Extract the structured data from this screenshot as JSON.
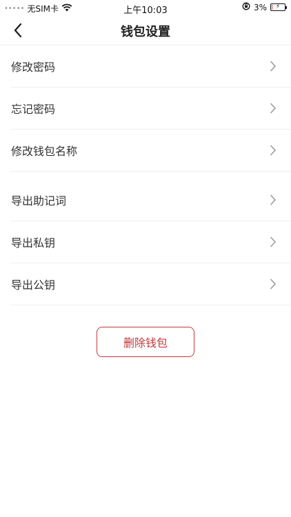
{
  "status_bar": {
    "carrier": "无SIM卡",
    "time": "上午10:03",
    "battery_percent": "3%",
    "signal_icon": "signal-dots-icon",
    "wifi_icon": "wifi-icon",
    "lock_rotation_icon": "orientation-lock-icon",
    "battery_icon": "battery-icon"
  },
  "nav": {
    "title": "钱包设置",
    "back_icon": "chevron-left-icon"
  },
  "menu": {
    "group1": [
      {
        "label": "修改密码"
      },
      {
        "label": "忘记密码"
      },
      {
        "label": "修改钱包名称"
      }
    ],
    "group2": [
      {
        "label": "导出助记词"
      },
      {
        "label": "导出私钥"
      },
      {
        "label": "导出公钥"
      }
    ]
  },
  "actions": {
    "delete_label": "删除钱包"
  },
  "colors": {
    "accent_red": "#c0393b",
    "text": "#333333",
    "divider": "#eeeeee",
    "chevron": "#9a9a9a"
  }
}
